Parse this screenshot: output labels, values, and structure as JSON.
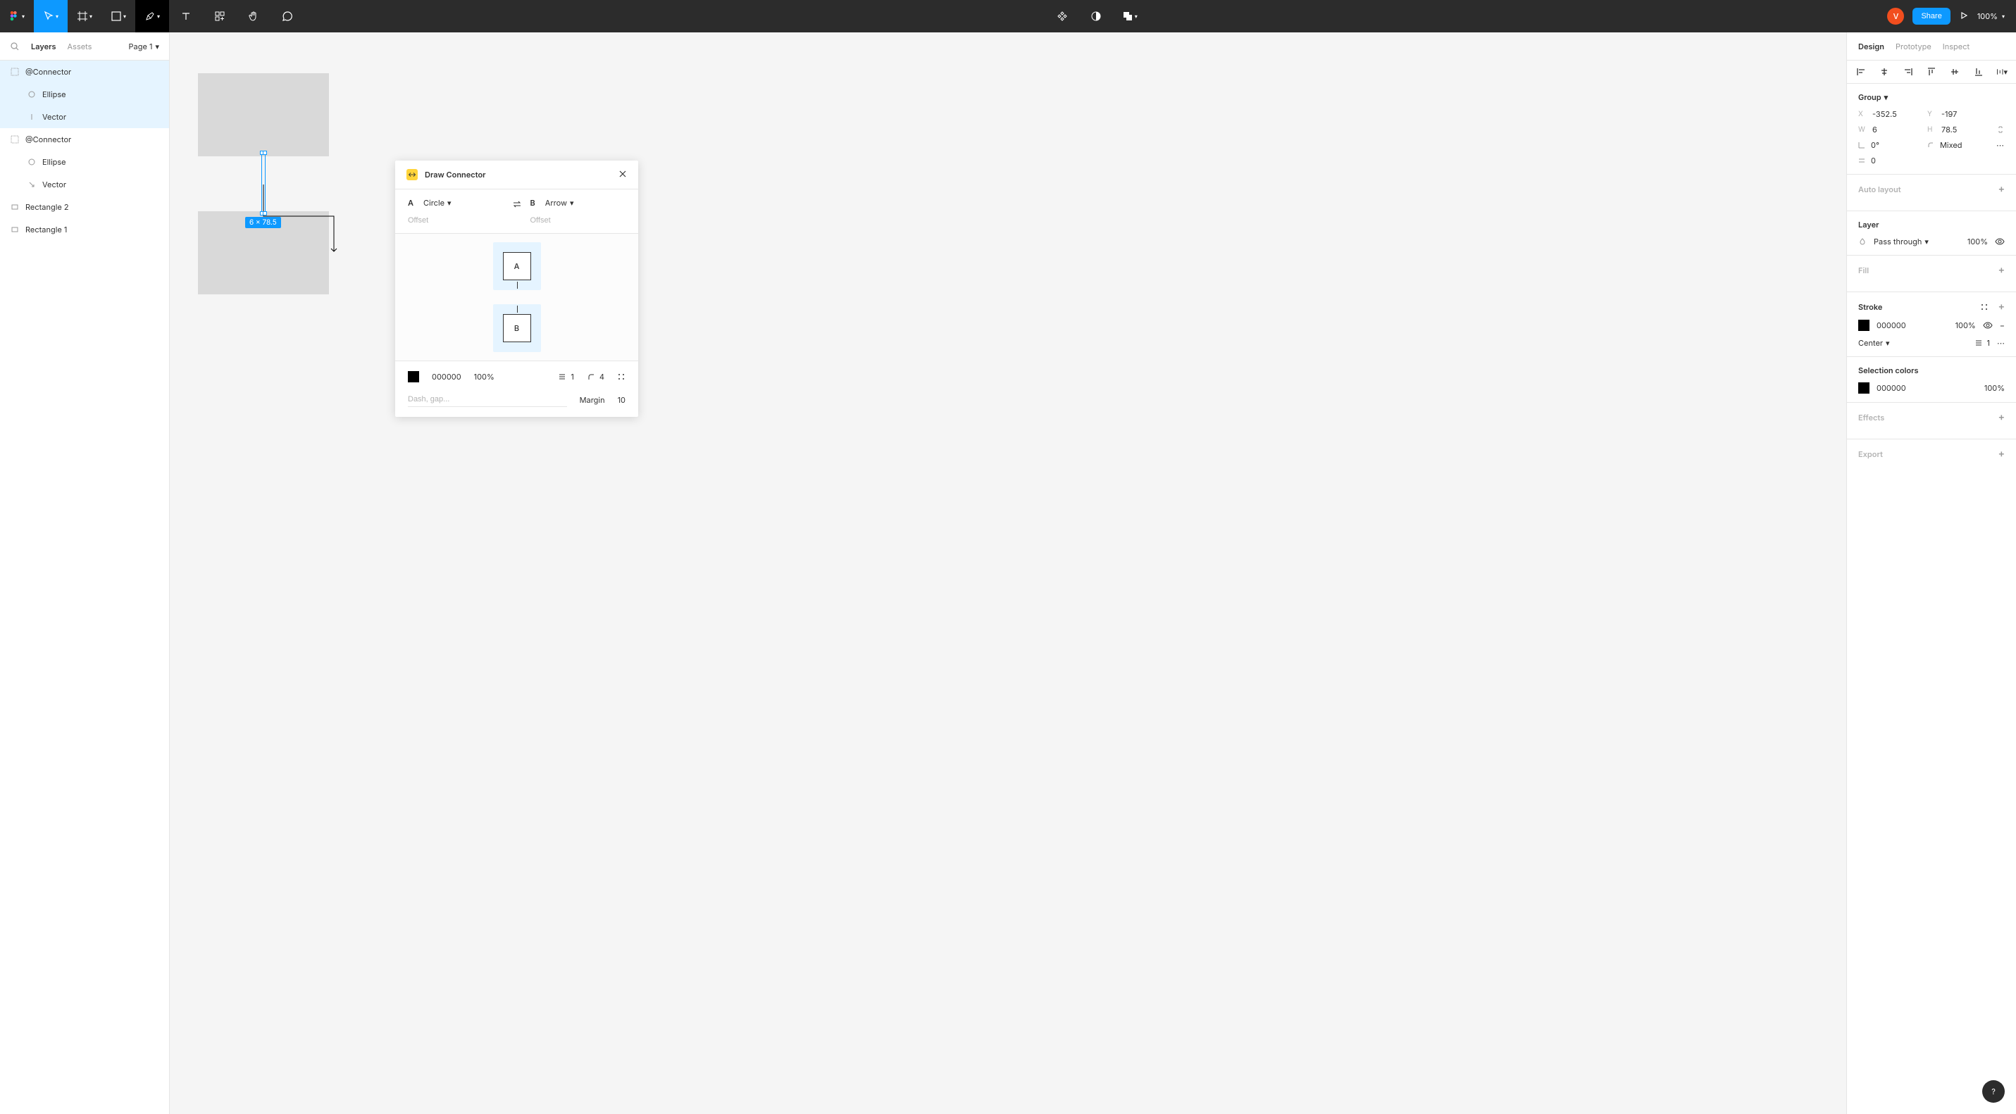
{
  "toolbar": {
    "avatar_letter": "V",
    "share_label": "Share",
    "zoom": "100%"
  },
  "left_panel": {
    "tabs": {
      "layers": "Layers",
      "assets": "Assets"
    },
    "page": "Page 1",
    "layers": [
      {
        "name": "@Connector",
        "type": "group",
        "selected": true
      },
      {
        "name": "Ellipse",
        "type": "ellipse",
        "selected": true,
        "indent": true
      },
      {
        "name": "Vector",
        "type": "vector",
        "selected": true,
        "indent": true
      },
      {
        "name": "@Connector",
        "type": "group"
      },
      {
        "name": "Ellipse",
        "type": "ellipse",
        "indent": true
      },
      {
        "name": "Vector",
        "type": "vector-arrow",
        "indent": true
      },
      {
        "name": "Rectangle 2",
        "type": "rect"
      },
      {
        "name": "Rectangle 1",
        "type": "rect"
      }
    ]
  },
  "canvas": {
    "dimensions_label": "6 × 78.5"
  },
  "plugin": {
    "title": "Draw Connector",
    "endpoint_a": {
      "label": "A",
      "shape": "Circle",
      "offset_placeholder": "Offset"
    },
    "endpoint_b": {
      "label": "B",
      "shape": "Arrow",
      "offset_placeholder": "Offset"
    },
    "diagram": {
      "a": "A",
      "b": "B"
    },
    "stroke": {
      "color": "000000",
      "opacity": "100%",
      "width": "1",
      "radius": "4",
      "dash_placeholder": "Dash, gap...",
      "margin_label": "Margin",
      "margin": "10"
    }
  },
  "right_panel": {
    "tabs": {
      "design": "Design",
      "prototype": "Prototype",
      "inspect": "Inspect"
    },
    "group": {
      "title": "Group",
      "x": "-352.5",
      "y": "-197",
      "w": "6",
      "h": "78.5",
      "rotation": "0°",
      "radius": "Mixed",
      "gap": "0"
    },
    "auto_layout": "Auto layout",
    "layer": {
      "title": "Layer",
      "blend": "Pass through",
      "opacity": "100%"
    },
    "fill": "Fill",
    "stroke": {
      "title": "Stroke",
      "color": "000000",
      "opacity": "100%",
      "position": "Center",
      "width": "1"
    },
    "selection_colors": {
      "title": "Selection colors",
      "color": "000000",
      "opacity": "100%"
    },
    "effects": "Effects",
    "export": "Export"
  }
}
